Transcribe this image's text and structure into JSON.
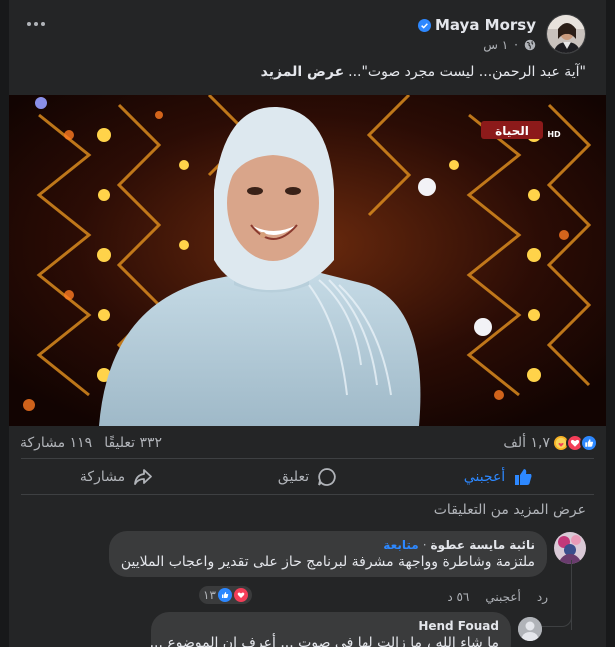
{
  "post": {
    "author": "Maya Morsy",
    "time": "١ س",
    "separator": "·",
    "caption": "\"آية عبد الرحمن... ليست مجرد صوت\"...",
    "see_more": "عرض المزيد"
  },
  "video": {
    "channel_logo_text": "الحياة",
    "channel_badge": "HD"
  },
  "stats": {
    "reactions_count": "١,٧ ألف",
    "comments_count": "٣٣٢ تعليقًا",
    "shares_count": "١١٩ مشاركة"
  },
  "actions": {
    "like": "أعجبني",
    "comment": "تعليق",
    "share": "مشاركة"
  },
  "more_comments": "عرض المزيد من التعليقات",
  "comments": [
    {
      "name": "نائبة مايسة عطوة",
      "follow": "متابعة",
      "separator": "·",
      "text": "ملتزمة وشاطرة وواجهة مشرفة لبرنامج حاز على تقدير واعجاب الملايين",
      "time": "٥٦ د",
      "like": "أعجبني",
      "reply": "رد",
      "reactions_count": "١٣"
    },
    {
      "name": "Hend Fouad",
      "text": "ما شاء الله ، ما زالت لها في صوت ... أعرف إن الموضوع ..."
    }
  ],
  "colors": {
    "accent": "#2d88ff",
    "background": "#242526",
    "bubble": "#3a3b3c"
  }
}
